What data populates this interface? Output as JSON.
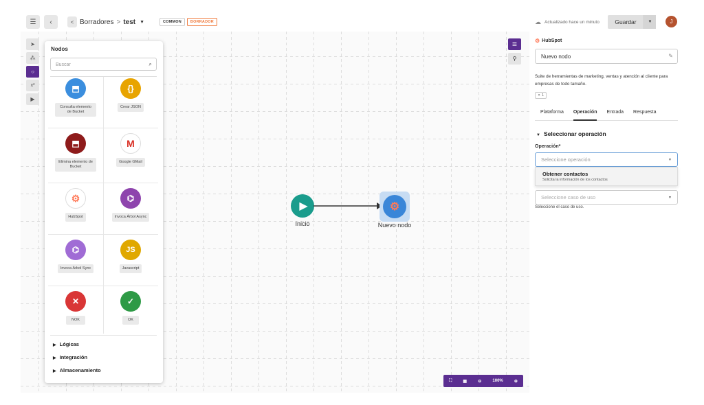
{
  "topbar": {
    "breadcrumb_parent": "Borradores",
    "breadcrumb_sep": ">",
    "breadcrumb_current": "test",
    "tag_common": "COMMON",
    "tag_draft": "BORRADOR",
    "save_status": "Actualizado hace un minuto",
    "save_button": "Guardar",
    "avatar_initial": "J"
  },
  "nodes_panel": {
    "title": "Nodos",
    "search_placeholder": "Buscar",
    "items": [
      {
        "label": "Consulta elemento de Bucket",
        "icon": "bucket-query-icon",
        "color": "#3b8ede"
      },
      {
        "label": "Crear JSON",
        "icon": "json-braces-icon",
        "glyph": "{}",
        "color": "#e8a400"
      },
      {
        "label": "Elimina elemento de Bucket",
        "icon": "bucket-delete-icon",
        "color": "#8e1b1b"
      },
      {
        "label": "Google GMail",
        "icon": "gmail-icon",
        "glyph": "M",
        "color": "#ffffff"
      },
      {
        "label": "HubSpot",
        "icon": "hubspot-icon",
        "color": "#ffffff"
      },
      {
        "label": "Invoca Árbol Async",
        "icon": "tree-async-icon",
        "color": "#8e44ad"
      },
      {
        "label": "Invoca Árbol Sync",
        "icon": "tree-sync-icon",
        "color": "#a06cd5"
      },
      {
        "label": "Javascript",
        "icon": "javascript-icon",
        "glyph": "JS",
        "color": "#e0a800"
      },
      {
        "label": "NOK",
        "icon": "nok-icon",
        "glyph": "✕",
        "color": "#d93636"
      },
      {
        "label": "OK",
        "icon": "ok-icon",
        "glyph": "✓",
        "color": "#2e9a46"
      }
    ],
    "sections": [
      "Lógicas",
      "Integración",
      "Almacenamiento"
    ]
  },
  "flow": {
    "start_label": "Inicio",
    "new_node_label": "Nuevo nodo"
  },
  "zoom": {
    "level": "100%"
  },
  "right_panel": {
    "integration_name": "HubSpot",
    "node_name": "Nuevo nodo",
    "description": "Suite de herramientas de marketing, ventas y atención al cliente para empresas de todo tamaño.",
    "badge": "1",
    "tabs": [
      "Plataforma",
      "Operación",
      "Entrada",
      "Respuesta"
    ],
    "active_tab": "Operación",
    "section_title": "Seleccionar operación",
    "operation_label": "Operación*",
    "operation_placeholder": "Seleccione operación",
    "dropdown_option_title": "Obtener contactos",
    "dropdown_option_desc": "Solicita la información de los contactos",
    "use_case_placeholder": "Seleccione caso de uso",
    "use_case_help": "Seleccione el caso de uso."
  },
  "colors": {
    "accent": "#5b2e91",
    "start_node": "#1a9c8c",
    "hubspot": "#ff7a59",
    "draft_tag": "#f07a3c"
  }
}
